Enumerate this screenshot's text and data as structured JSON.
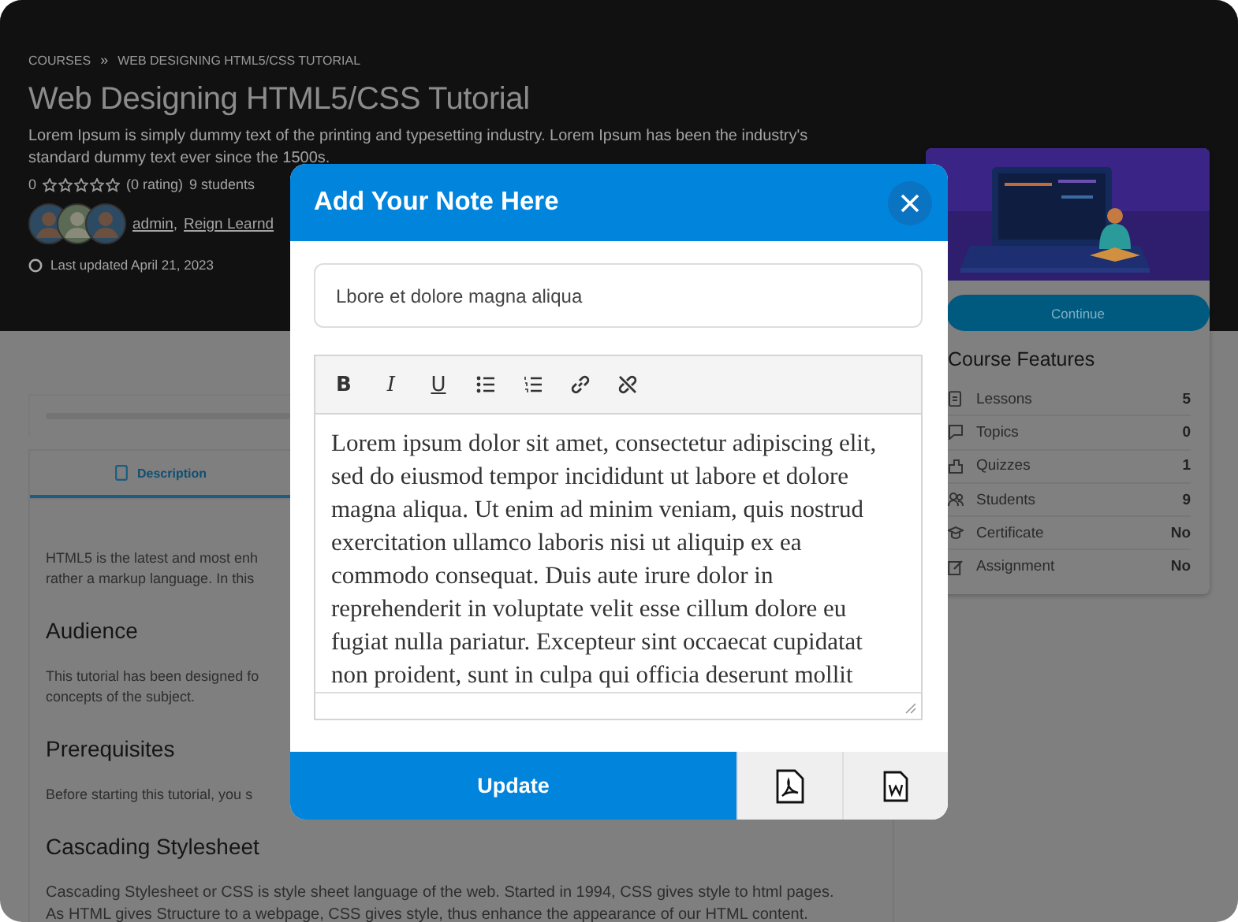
{
  "breadcrumb": {
    "items": [
      "COURSES",
      "WEB DESIGNING HTML5/CSS TUTORIAL"
    ],
    "separator": "»"
  },
  "course": {
    "title": "Web Designing HTML5/CSS Tutorial",
    "description": "Lorem Ipsum is simply dummy text of the printing and typesetting industry. Lorem Ipsum has been the industry's standard dummy text ever since the 1500s.",
    "rating": "0",
    "stars": 0,
    "rating_count": "(0 rating)",
    "students": "9 students",
    "avatars": [
      {
        "kind": "person"
      },
      {
        "kind": "group"
      },
      {
        "kind": "person"
      }
    ],
    "authors": [
      "admin",
      "Reign Learnd"
    ],
    "author_separator": ",",
    "updated": "Last updated April 21, 2023"
  },
  "progress": {
    "level": 0
  },
  "tabs": [
    {
      "label": "Description",
      "selected": true
    }
  ],
  "content": [
    {
      "kind": "paragraph",
      "lines": [
        "HTML5 is the latest and most enh",
        "rather a markup language. In this"
      ]
    },
    {
      "kind": "heading",
      "text": "Audience"
    },
    {
      "kind": "paragraph",
      "lines": [
        "This tutorial has been designed fo",
        "concepts of the subject."
      ]
    },
    {
      "kind": "heading",
      "text": "Prerequisites"
    },
    {
      "kind": "paragraph",
      "lines": [
        "Before starting this tutorial, you s"
      ]
    },
    {
      "kind": "heading",
      "text": "Cascading Stylesheet"
    },
    {
      "kind": "paragraph",
      "lines": [
        "Cascading Stylesheet or CSS is style sheet language of the web. Started in 1994, CSS gives style to html pages.",
        "As HTML gives Structure to a webpage, CSS gives style, thus enhance the appearance of our HTML content."
      ]
    }
  ],
  "sidebar": {
    "continue_button": "Continue",
    "features_title": "Course Features",
    "features": [
      {
        "kind": "lessons",
        "label": "Lessons",
        "value": "5"
      },
      {
        "kind": "topics",
        "label": "Topics",
        "value": "0"
      },
      {
        "kind": "quizzes",
        "label": "Quizzes",
        "value": "1"
      },
      {
        "kind": "students",
        "label": "Students",
        "value": "9"
      },
      {
        "kind": "certificate",
        "label": "Certificate",
        "value": "No"
      },
      {
        "kind": "assignment",
        "label": "Assignment",
        "value": "No"
      }
    ]
  },
  "note_modal": {
    "title": "Add Your Note Here",
    "title_field": {
      "value": "Lbore et dolore magna aliqua"
    },
    "toolbar": [
      {
        "kind": "bold",
        "label": "B"
      },
      {
        "kind": "italic",
        "label": "I"
      },
      {
        "kind": "underline",
        "label": "U"
      },
      {
        "kind": "bullet-list"
      },
      {
        "kind": "numbered-list"
      },
      {
        "kind": "link"
      },
      {
        "kind": "unlink"
      }
    ],
    "body": "Lorem ipsum dolor sit amet, consectetur adipiscing elit, sed do eiusmod tempor incididunt ut labore et dolore magna aliqua. Ut enim ad minim veniam, quis nostrud exercitation ullamco laboris nisi ut aliquip ex ea commodo consequat. Duis aute irure dolor in reprehenderit in voluptate velit esse cillum dolore eu fugiat nulla pariatur. Excepteur sint occaecat cupidatat non proident, sunt in culpa qui officia deserunt mollit",
    "buttons": [
      {
        "kind": "update",
        "label": "Update"
      },
      {
        "kind": "pdf"
      },
      {
        "kind": "word"
      }
    ]
  }
}
